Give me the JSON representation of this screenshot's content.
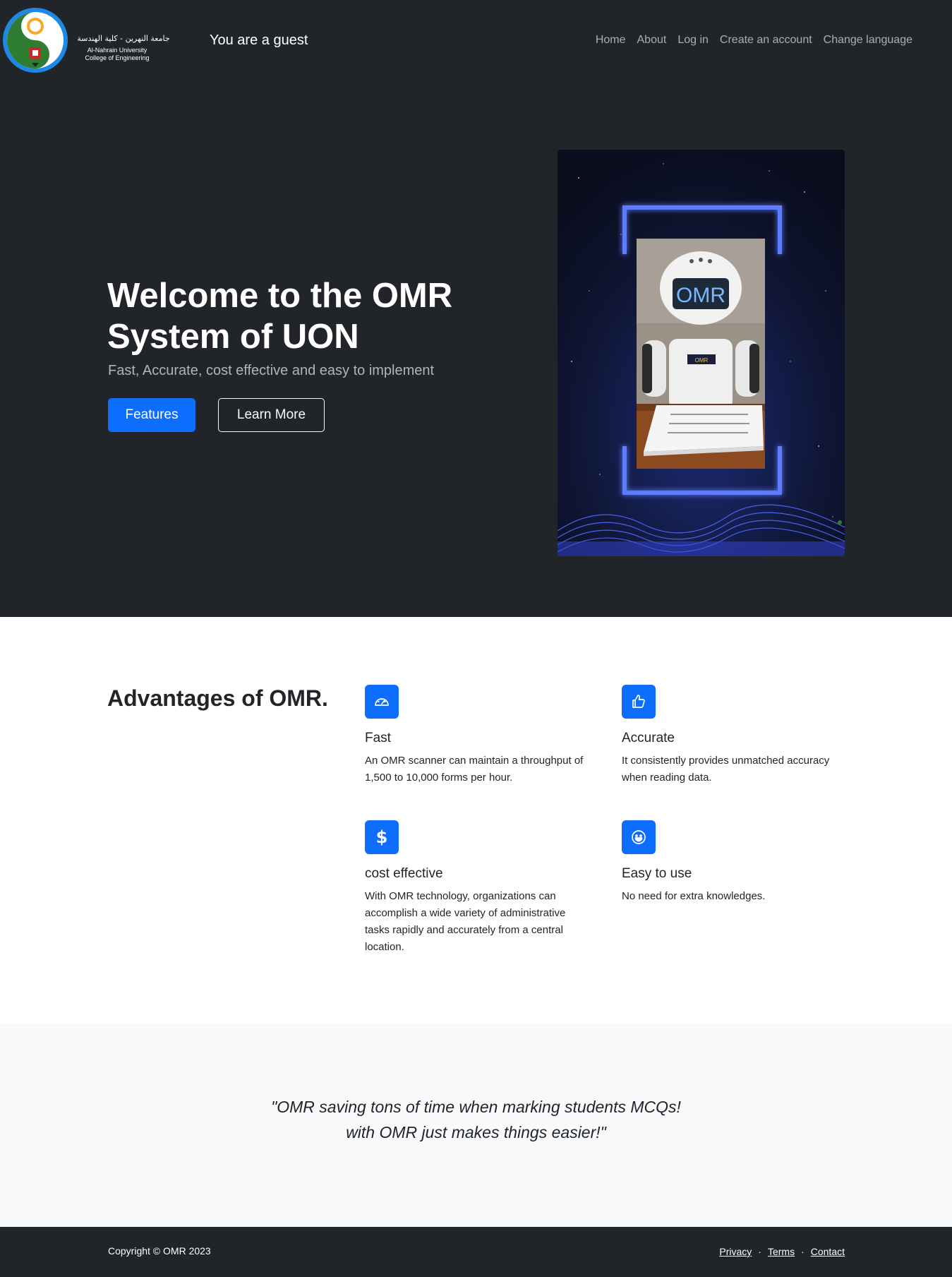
{
  "nav": {
    "logo_text_arabic": "جامعة النهرين - كلية الهندسة",
    "logo_text_line1": "Al-Nahrain University",
    "logo_text_line2": "College of Engineering",
    "guest_label": "You are a guest",
    "links": [
      "Home",
      "About",
      "Log in",
      "Create an account",
      "Change language"
    ]
  },
  "hero": {
    "title": "Welcome to the OMR System of UON",
    "subtitle": "Fast, Accurate, cost effective and easy to implement",
    "primary_button": "Features",
    "secondary_button": "Learn More",
    "image_screen_text": "OMR",
    "image_badge_text": "OMR"
  },
  "features": {
    "heading": "Advantages of OMR.",
    "items": [
      {
        "title": "Fast",
        "text": "An OMR scanner can maintain a throughput of 1,500 to 10,000 forms per hour.",
        "icon": "speedometer-icon"
      },
      {
        "title": "Accurate",
        "text": "It consistently provides unmatched accuracy when reading data.",
        "icon": "thumbs-up-icon"
      },
      {
        "title": "cost effective",
        "text": "With OMR technology, organizations can accomplish a wide variety of administrative tasks rapidly and accurately from a central location.",
        "icon": "dollar-icon"
      },
      {
        "title": "Easy to use",
        "text": "No need for extra knowledges.",
        "icon": "smile-icon"
      }
    ]
  },
  "testimonial": {
    "quote": "\"OMR saving tons of time when marking students MCQs! with OMR just makes things easier!\""
  },
  "footer": {
    "copyright": "Copyright © OMR 2023",
    "links": [
      "Privacy",
      "Terms",
      "Contact"
    ],
    "separator": "·"
  },
  "colors": {
    "dark": "#212529",
    "primary": "#0d6efd",
    "light": "#f8f9fa",
    "muted": "#adb5bd"
  }
}
